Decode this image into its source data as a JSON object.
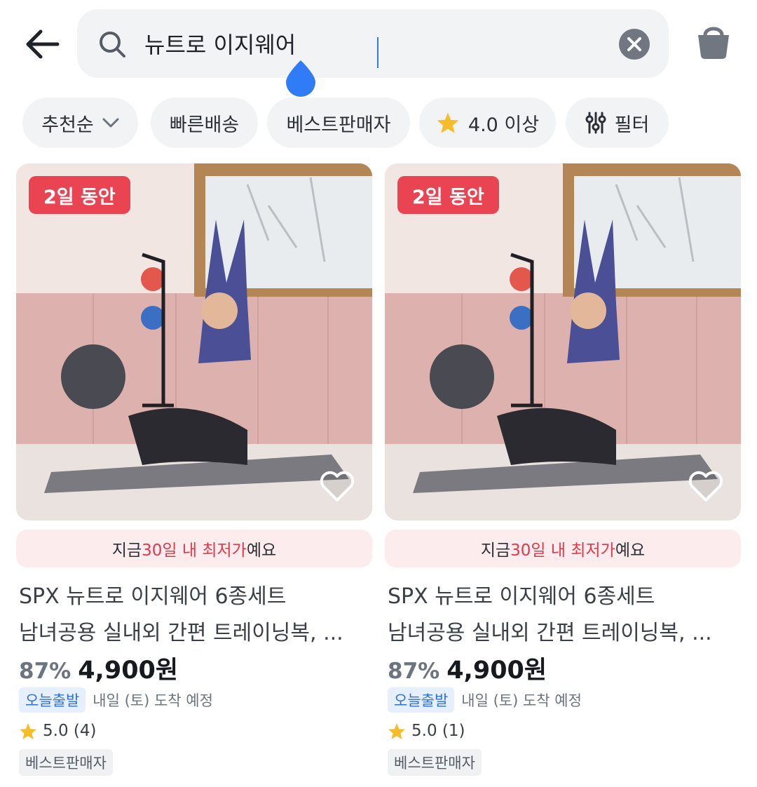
{
  "header": {
    "search_value": "뉴트로 이지웨어",
    "back_icon": "arrow-left-icon",
    "search_icon": "search-icon",
    "clear_icon": "close-circle-icon",
    "cart_icon": "shopping-bag-icon"
  },
  "filters": {
    "sort_label": "추천순",
    "fast_delivery_label": "빠른배송",
    "best_seller_label": "베스트판매자",
    "rating_label": "4.0 이상",
    "filter_label": "필터"
  },
  "colors": {
    "accent_red": "#ea4453",
    "accent_blue": "#2f7cf6",
    "star_yellow": "#f6bd2b"
  },
  "products": [
    {
      "badge": "2일 동안",
      "promo_prefix": "지금 ",
      "promo_highlight": "30일 내 최저가",
      "promo_suffix": "예요",
      "title_line1": "SPX 뉴트로 이지웨어 6종세트",
      "title_line2": "남녀공용 실내외 간편 트레이닝복, ...",
      "discount": "87%",
      "price": "4,900원",
      "delivery_badge": "오늘출발",
      "delivery_text": "내일 (토) 도착 예정",
      "rating": "5.0 (4)",
      "seller_tag": "베스트판매자"
    },
    {
      "badge": "2일 동안",
      "promo_prefix": "지금 ",
      "promo_highlight": "30일 내 최저가",
      "promo_suffix": "예요",
      "title_line1": "SPX 뉴트로 이지웨어 6종세트",
      "title_line2": "남녀공용 실내외 간편 트레이닝복, ...",
      "discount": "87%",
      "price": "4,900원",
      "delivery_badge": "오늘출발",
      "delivery_text": "내일 (토) 도착 예정",
      "rating": "5.0 (1)",
      "seller_tag": "베스트판매자"
    }
  ]
}
